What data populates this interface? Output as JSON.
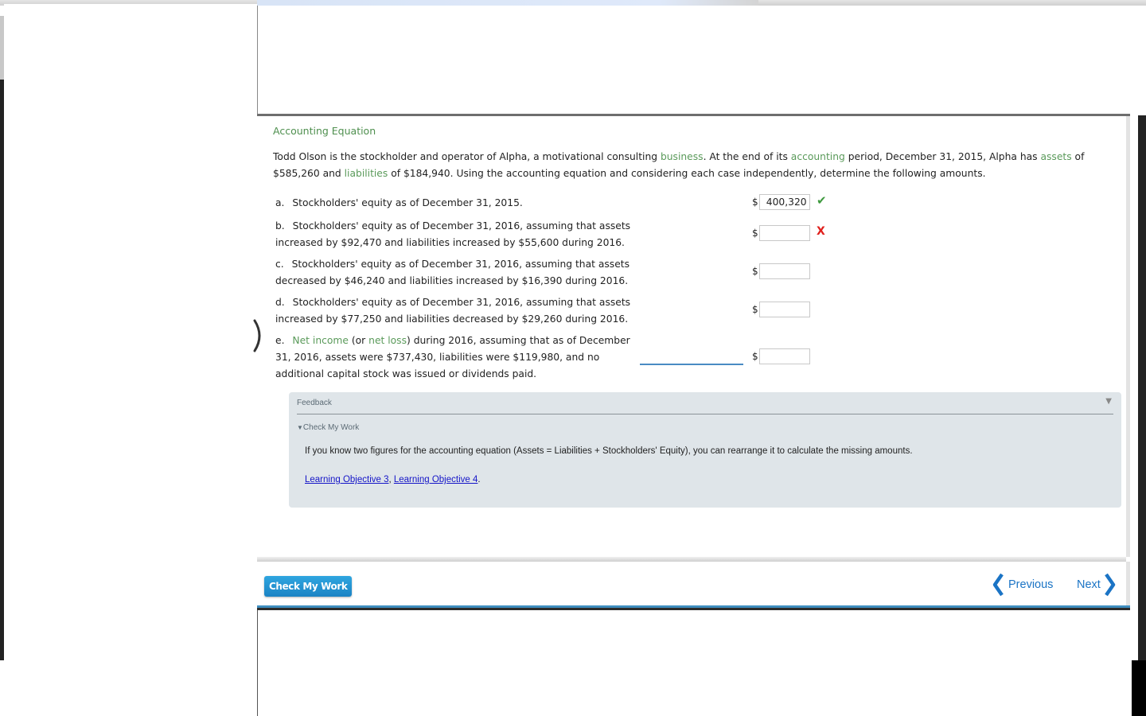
{
  "panel": {
    "title": "Accounting Equation",
    "intro": {
      "p1": "Todd Olson is the stockholder and operator of Alpha, a motivational consulting ",
      "term_business": "business",
      "p2": ". At the end of its ",
      "term_accounting": "accounting",
      "p3": " period, December 31, 2015, Alpha has ",
      "term_assets": "assets",
      "p4": " of $585,260 and ",
      "term_liabilities": "liabilities",
      "p5": " of $184,940. Using the accounting equation and considering each case independently, determine the following amounts."
    },
    "questions": [
      {
        "label": "a.",
        "text": "Stockholders' equity as of December 31, 2015.",
        "currency": "$",
        "value": "400,320",
        "status": "correct"
      },
      {
        "label": "b.",
        "text": "Stockholders' equity as of December 31, 2016, assuming that assets increased by $92,470 and liabilities increased by $55,600 during 2016.",
        "currency": "$",
        "value": "",
        "status": "incorrect"
      },
      {
        "label": "c.",
        "text": "Stockholders' equity as of December 31, 2016, assuming that assets decreased by $46,240 and liabilities increased by $16,390 during 2016.",
        "currency": "$",
        "value": "",
        "status": ""
      },
      {
        "label": "d.",
        "text": "Stockholders' equity as of December 31, 2016, assuming that assets increased by $77,250 and liabilities decreased by $29,260 during 2016.",
        "currency": "$",
        "value": "",
        "status": ""
      },
      {
        "label": "e.",
        "term1": "Net income",
        "t1": " (or ",
        "term2": "net loss",
        "t2": ") during 2016, assuming that as of December 31, 2016, assets were $737,430, liabilities were $119,980, and no additional capital stock was issued or dividends paid.",
        "currency": "$",
        "value": "",
        "status": ""
      }
    ],
    "marks": {
      "correct": "✔",
      "incorrect": "X"
    }
  },
  "feedback": {
    "heading": "Feedback",
    "toggle_icon": "▼",
    "section": "Check My Work",
    "section_icon": "▼",
    "text": "If you know two figures for the accounting equation (Assets = Liabilities + Stockholders' Equity), you can rearrange it to calculate the missing amounts.",
    "links": [
      "Learning Objective 3",
      "Learning Objective 4"
    ],
    "link_sep": ", ",
    "link_end": "."
  },
  "toolbar": {
    "check_label": "Check My Work",
    "previous_label": "Previous",
    "next_label": "Next"
  },
  "colors": {
    "term_green": "#5a9a5a",
    "accent_blue": "#1b74c5",
    "button_blue": "#1b83c4",
    "correct": "#3f9a3f",
    "incorrect": "#e0201c",
    "feedback_bg": "#dfe5e9"
  }
}
